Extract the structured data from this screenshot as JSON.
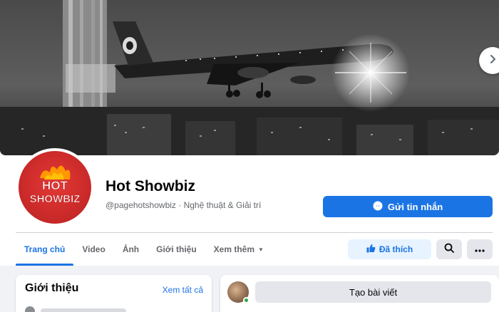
{
  "cover": {
    "next_icon": "chevron-right-icon"
  },
  "page": {
    "name": "Hot Showbiz",
    "handle": "@pagehotshowbiz · Nghệ thuật & Giải trí",
    "avatar_text_top": "HOT",
    "avatar_text_bottom": "SHOWBIZ"
  },
  "actions": {
    "message_label": "Gửi tin nhắn",
    "message_icon": "messenger-icon",
    "like_label": "Đã thích",
    "like_icon": "thumbs-up-icon",
    "search_icon": "search-icon",
    "more_icon": "more-icon"
  },
  "tabs": [
    {
      "label": "Trang chủ",
      "active": true
    },
    {
      "label": "Video"
    },
    {
      "label": "Ảnh"
    },
    {
      "label": "Giới thiệu"
    },
    {
      "label": "Xem thêm"
    }
  ],
  "intro": {
    "title": "Giới thiệu",
    "link": "Xem tất cả"
  },
  "composer": {
    "label": "Tạo bài viết"
  },
  "colors": {
    "accent": "#1b74e4",
    "avatar_red": "#d32f2f",
    "online": "#31a24c"
  }
}
